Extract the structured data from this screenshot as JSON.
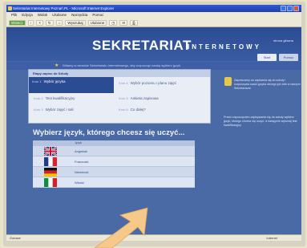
{
  "window": {
    "title": "Sekretariat Internetowy Poznań.PL - Microsoft Internet Explorer",
    "menu": [
      "Plik",
      "Edycja",
      "Widok",
      "Ulubione",
      "Narzędzia",
      "Pomoc"
    ],
    "toolbar": [
      "Wstecz",
      "Wyszukaj",
      "Ulubione"
    ]
  },
  "site": {
    "logo": "SEKRETARIAT",
    "logo_sub": "INTERNETOWY",
    "corner_link": "strona główna",
    "tabs": [
      "Start",
      "Pomoc"
    ],
    "notice": "Witamy w serwisie Sekretariatu Internetowego, aby rozpocząć naukę wybierz język"
  },
  "steps": {
    "header": "Etapy zapisu do Szkoły",
    "items": [
      {
        "num": "Krok 1",
        "label": "Wybór języka"
      },
      {
        "num": "Krok 2",
        "label": "Test kwalifikacyjny"
      },
      {
        "num": "Krok 3",
        "label": "Wybór zajęć i sali"
      },
      {
        "num": "Krok 4",
        "label": "Wybór poziomu i planu zajęć"
      },
      {
        "num": "Krok 5",
        "label": "Ankieta zapisowa"
      },
      {
        "num": "Krok 6",
        "label": "Co dalej?"
      }
    ]
  },
  "main": {
    "heading": "Wybierz język, którego chcesz się uczyć...",
    "table_header": "Język",
    "languages": [
      {
        "name": "Angielski",
        "flag": "uk"
      },
      {
        "name": "Francuski",
        "flag": "fr"
      },
      {
        "name": "Niemiecki",
        "flag": "de"
      },
      {
        "name": "Włoski",
        "flag": "it"
      }
    ]
  },
  "sidebar": {
    "text1": "Zapraszamy do zapisania się do szkoły i rozpoczęcia nauki języka obcego już dziś w naszym Sekretariacie",
    "text2": "Przed rozpoczęciem zapisywania się do szkoły wybierz język, którego chcesz się uczyć, a następnie wykonaj test kwalifikacyjny"
  },
  "status": {
    "left": "Gotowe",
    "zone": "Internet"
  },
  "colors": {
    "page": "#4a6aa6",
    "banner": "#2b4c93",
    "arrow": "#f6c98a"
  }
}
